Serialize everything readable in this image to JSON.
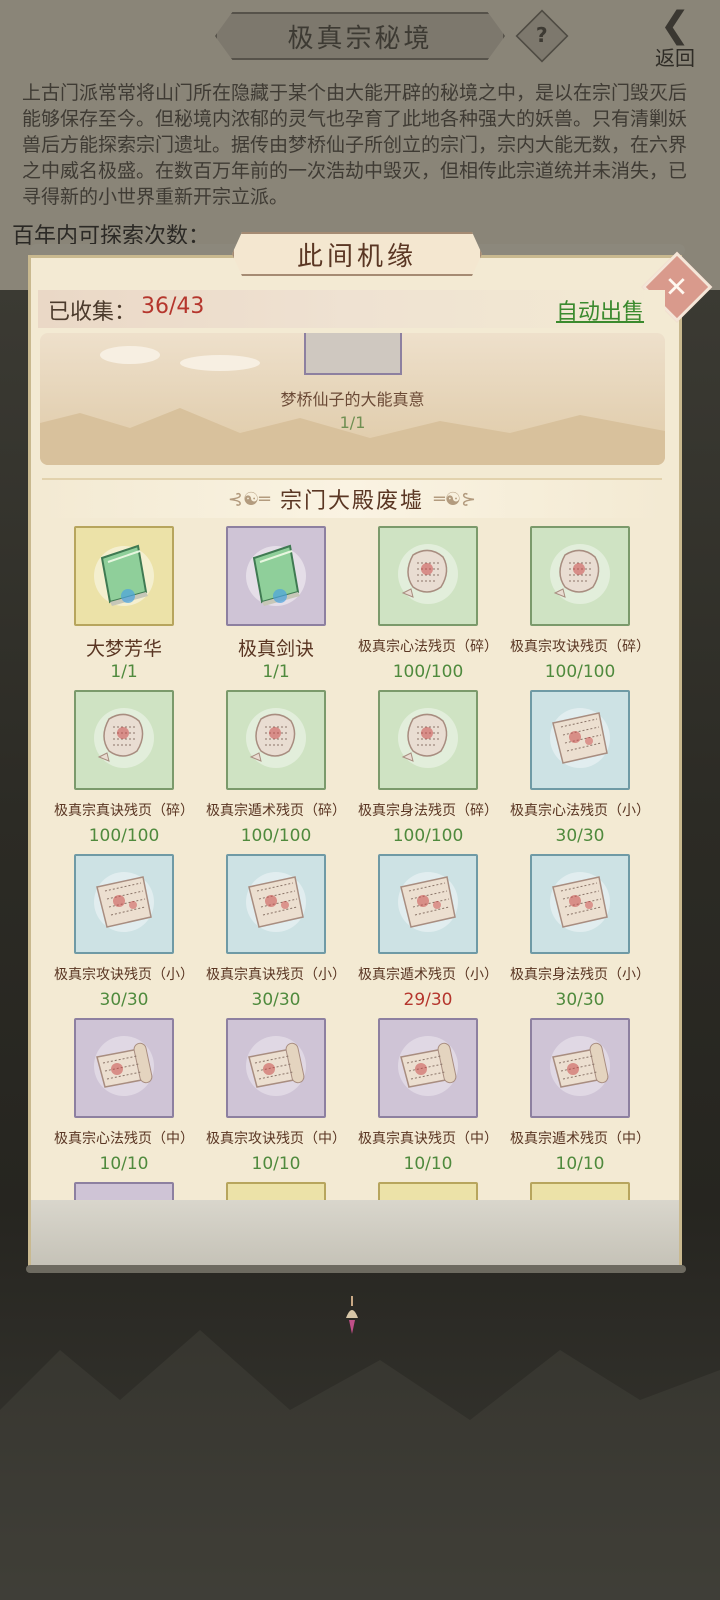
{
  "header": {
    "title": "极真宗秘境",
    "help_label": "?",
    "back_label": "返回"
  },
  "intro_text": "上古门派常常将山门所在隐藏于某个由大能开辟的秘境之中，是以在宗门毁灭后能够保存至今。但秘境内浓郁的灵气也孕育了此地各种强大的妖兽。只有清剿妖兽后方能探索宗门遗址。据传由梦桥仙子所创立的宗门，宗内大能无数，在六界之中威名极盛。在数百万年前的一次浩劫中毁灭，但相传此宗道统并未消失，已寻得新的小世界重新开宗立派。",
  "explore_text": "百年内可探索次数：",
  "modal": {
    "title": "此间机缘",
    "close_label": "✕",
    "collected_label": "已收集：",
    "collected_value": "36/43",
    "auto_sell_label": "自动出售",
    "top_item": {
      "name": "梦桥仙子的大能真意",
      "count": "1/1"
    },
    "section_title": "宗门大殿废墟",
    "items": [
      {
        "name": "大梦芳华",
        "count": "1/1",
        "frame": "gold",
        "icon": "book-icon",
        "big": true
      },
      {
        "name": "极真剑诀",
        "count": "1/1",
        "frame": "purple",
        "icon": "book-icon",
        "big": true
      },
      {
        "name": "极真宗心法残页（碎）",
        "count": "100/100",
        "frame": "green",
        "icon": "torn-page-icon"
      },
      {
        "name": "极真宗攻诀残页（碎）",
        "count": "100/100",
        "frame": "green",
        "icon": "torn-page-icon"
      },
      {
        "name": "极真宗真诀残页（碎）",
        "count": "100/100",
        "frame": "green",
        "icon": "torn-page-icon"
      },
      {
        "name": "极真宗遁术残页（碎）",
        "count": "100/100",
        "frame": "green",
        "icon": "torn-page-icon"
      },
      {
        "name": "极真宗身法残页（碎）",
        "count": "100/100",
        "frame": "green",
        "icon": "torn-page-icon"
      },
      {
        "name": "极真宗心法残页（小）",
        "count": "30/30",
        "frame": "blue",
        "icon": "page-icon"
      },
      {
        "name": "极真宗攻诀残页（小）",
        "count": "30/30",
        "frame": "blue",
        "icon": "page-icon"
      },
      {
        "name": "极真宗真诀残页（小）",
        "count": "30/30",
        "frame": "blue",
        "icon": "page-icon"
      },
      {
        "name": "极真宗遁术残页（小）",
        "count": "29/30",
        "frame": "blue",
        "icon": "page-icon",
        "incomplete": true
      },
      {
        "name": "极真宗身法残页（小）",
        "count": "30/30",
        "frame": "blue",
        "icon": "page-icon"
      },
      {
        "name": "极真宗心法残页（中）",
        "count": "10/10",
        "frame": "purple",
        "icon": "scroll-icon"
      },
      {
        "name": "极真宗攻诀残页（中）",
        "count": "10/10",
        "frame": "purple",
        "icon": "scroll-icon"
      },
      {
        "name": "极真宗真诀残页（中）",
        "count": "10/10",
        "frame": "purple",
        "icon": "scroll-icon"
      },
      {
        "name": "极真宗遁术残页（中）",
        "count": "10/10",
        "frame": "purple",
        "icon": "scroll-icon"
      },
      {
        "name": "",
        "count": "",
        "frame": "purple",
        "icon": ""
      },
      {
        "name": "",
        "count": "",
        "frame": "gold",
        "icon": ""
      },
      {
        "name": "",
        "count": "",
        "frame": "gold",
        "icon": ""
      },
      {
        "name": "",
        "count": "",
        "frame": "gold",
        "icon": ""
      }
    ]
  },
  "colors": {
    "complete": "#4f8a3d",
    "incomplete": "#b5362d",
    "accent_green_link": "#3b8a2e"
  }
}
